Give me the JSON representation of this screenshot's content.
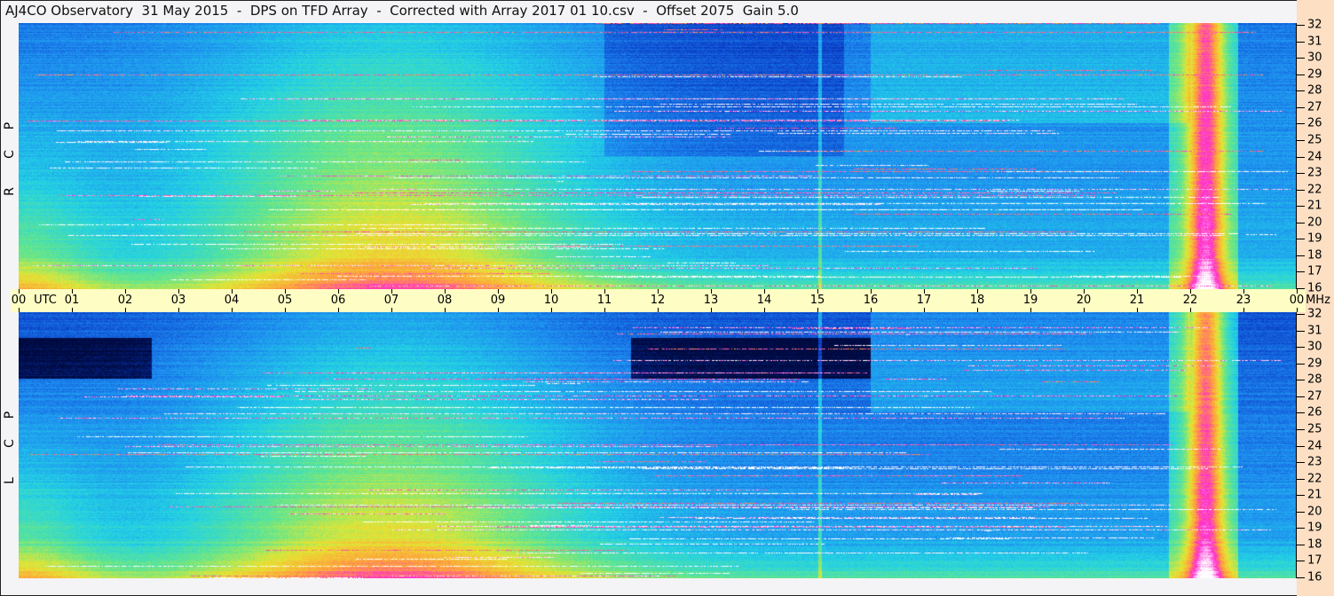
{
  "title": "AJ4CO Observatory  31 May 2015  -  DPS on TFD Array  -  Corrected with Array 2017 01 10.csv  -  Offset 2075  Gain 5.0",
  "chart_data": {
    "type": "heatmap",
    "title": "AJ4CO Observatory  31 May 2015  -  DPS on TFD Array  -  Corrected with Array 2017 01 10.csv  -  Offset 2075  Gain 5.0",
    "panels": [
      {
        "name": "R C P",
        "letters": [
          "R",
          "C",
          "P"
        ]
      },
      {
        "name": "L C P",
        "letters": [
          "L",
          "C",
          "P"
        ]
      }
    ],
    "x_axis": {
      "unit_label": "UTC",
      "range": [
        0,
        24
      ],
      "tick_labels": [
        "00",
        "01",
        "02",
        "03",
        "04",
        "05",
        "06",
        "07",
        "08",
        "09",
        "10",
        "11",
        "12",
        "13",
        "14",
        "15",
        "16",
        "17",
        "18",
        "19",
        "20",
        "21",
        "22",
        "23",
        "00"
      ]
    },
    "y_axis": {
      "unit_label": "MHz",
      "range": [
        16,
        32
      ],
      "tick_labels": [
        "32",
        "31",
        "30",
        "29",
        "28",
        "27",
        "26",
        "25",
        "24",
        "23",
        "22",
        "21",
        "20",
        "19",
        "18",
        "17",
        "16"
      ]
    },
    "colormap": [
      "#000a40",
      "#0a3cc8",
      "#1e8cf0",
      "#22d2e6",
      "#64e68c",
      "#e6e632",
      "#ffa03c",
      "#ff28d2",
      "#ffffff"
    ]
  }
}
